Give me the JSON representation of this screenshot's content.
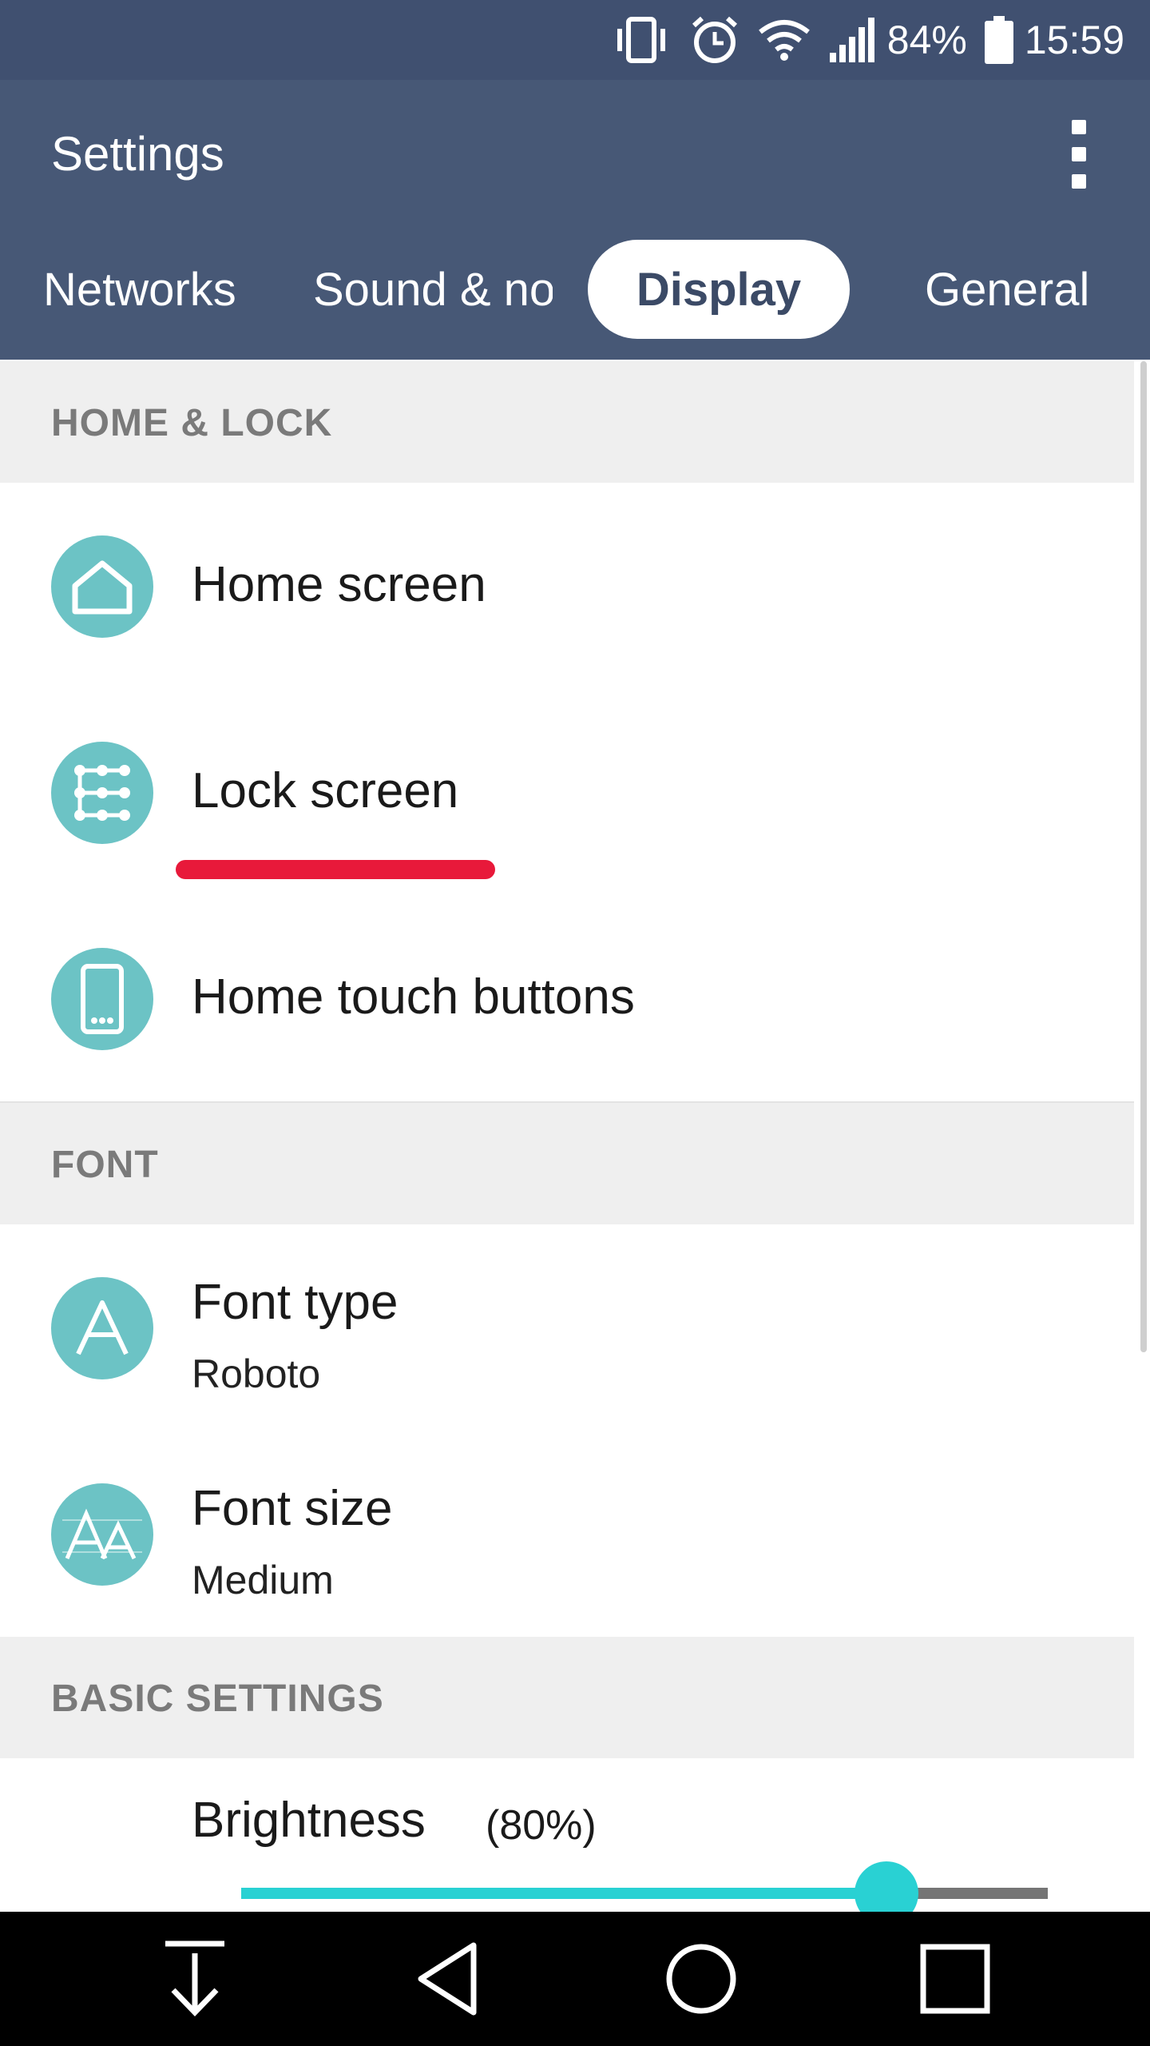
{
  "status_bar": {
    "battery": "84%",
    "time": "15:59"
  },
  "app_bar": {
    "title": "Settings"
  },
  "tabs": [
    {
      "label": "Networks"
    },
    {
      "label": "Sound & notification"
    },
    {
      "label": "Display",
      "active": true
    },
    {
      "label": "General"
    }
  ],
  "sections": {
    "home_lock": {
      "header": "HOME & LOCK",
      "items": [
        {
          "title": "Home screen",
          "icon": "home-icon"
        },
        {
          "title": "Lock screen",
          "icon": "pattern-lock-icon"
        },
        {
          "title": "Home touch buttons",
          "icon": "phone-buttons-icon"
        }
      ]
    },
    "font": {
      "header": "FONT",
      "items": [
        {
          "title": "Font type",
          "subtitle": "Roboto",
          "icon": "font-type-icon"
        },
        {
          "title": "Font size",
          "subtitle": "Medium",
          "icon": "font-size-icon"
        }
      ]
    },
    "basic": {
      "header": "BASIC SETTINGS",
      "brightness": {
        "label": "Brightness",
        "value_text": "(80%)",
        "level": 0.8
      }
    }
  },
  "colors": {
    "status_bar": "#405070",
    "app_bar": "#475876",
    "icon_circle": "#6cc3c5",
    "slider_accent": "#29d1d3",
    "highlight_underline": "#e8193a"
  },
  "nav_bar": {
    "buttons": [
      "download-icon",
      "back-icon",
      "home-icon",
      "recents-icon"
    ]
  }
}
